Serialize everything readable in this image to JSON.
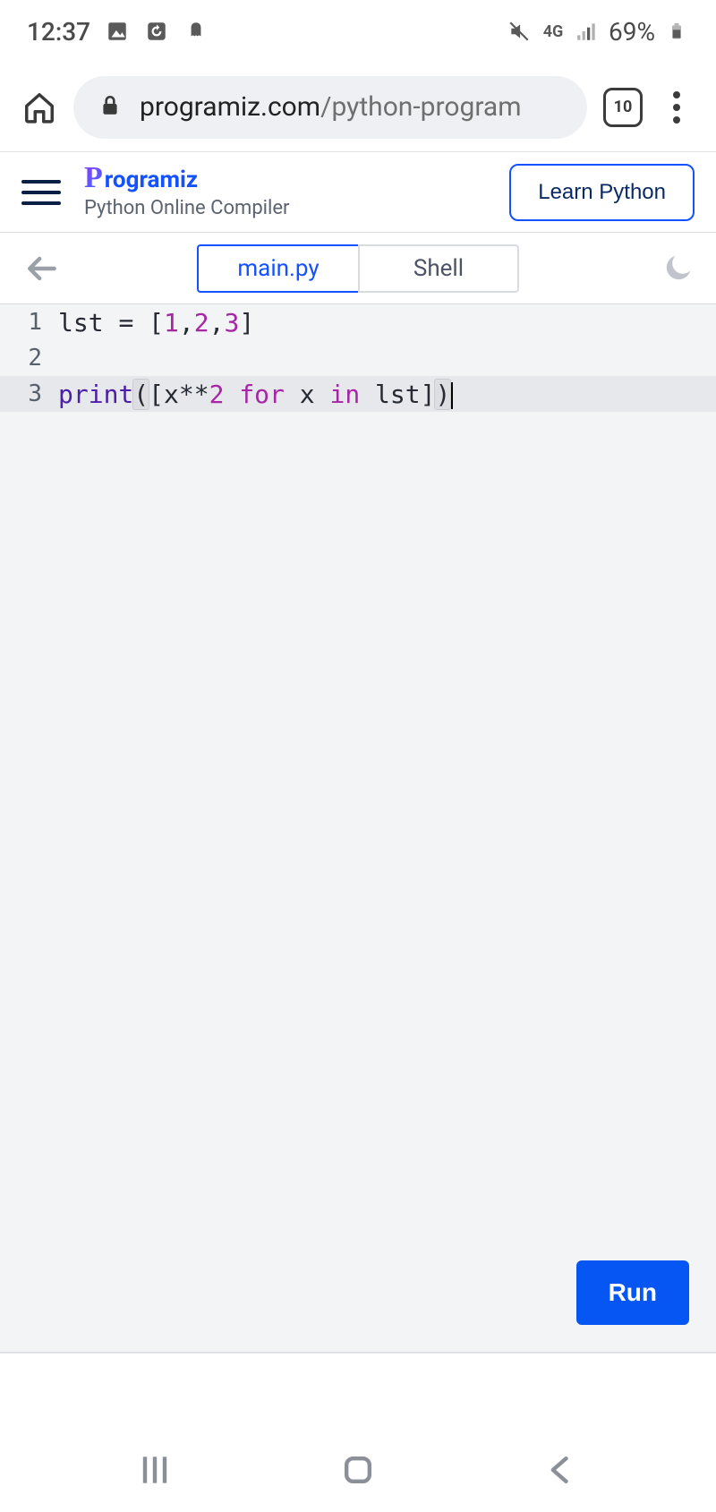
{
  "status": {
    "time": "12:37",
    "battery_pct": "69%",
    "network_label": "4G"
  },
  "browser": {
    "url_domain": "programiz.com",
    "url_path": "/python-program",
    "tab_count": "10"
  },
  "app": {
    "brand_prefix": "P",
    "brand_rest": "rogramiz",
    "subtitle": "Python Online Compiler",
    "learn_btn": "Learn Python"
  },
  "tabs": {
    "file": "main.py",
    "shell": "Shell"
  },
  "code": {
    "lines": [
      {
        "n": "1",
        "raw": "lst = [1,2,3]"
      },
      {
        "n": "2",
        "raw": ""
      },
      {
        "n": "3",
        "raw": "print([x**2 for x in lst])"
      }
    ]
  },
  "run_label": "Run"
}
